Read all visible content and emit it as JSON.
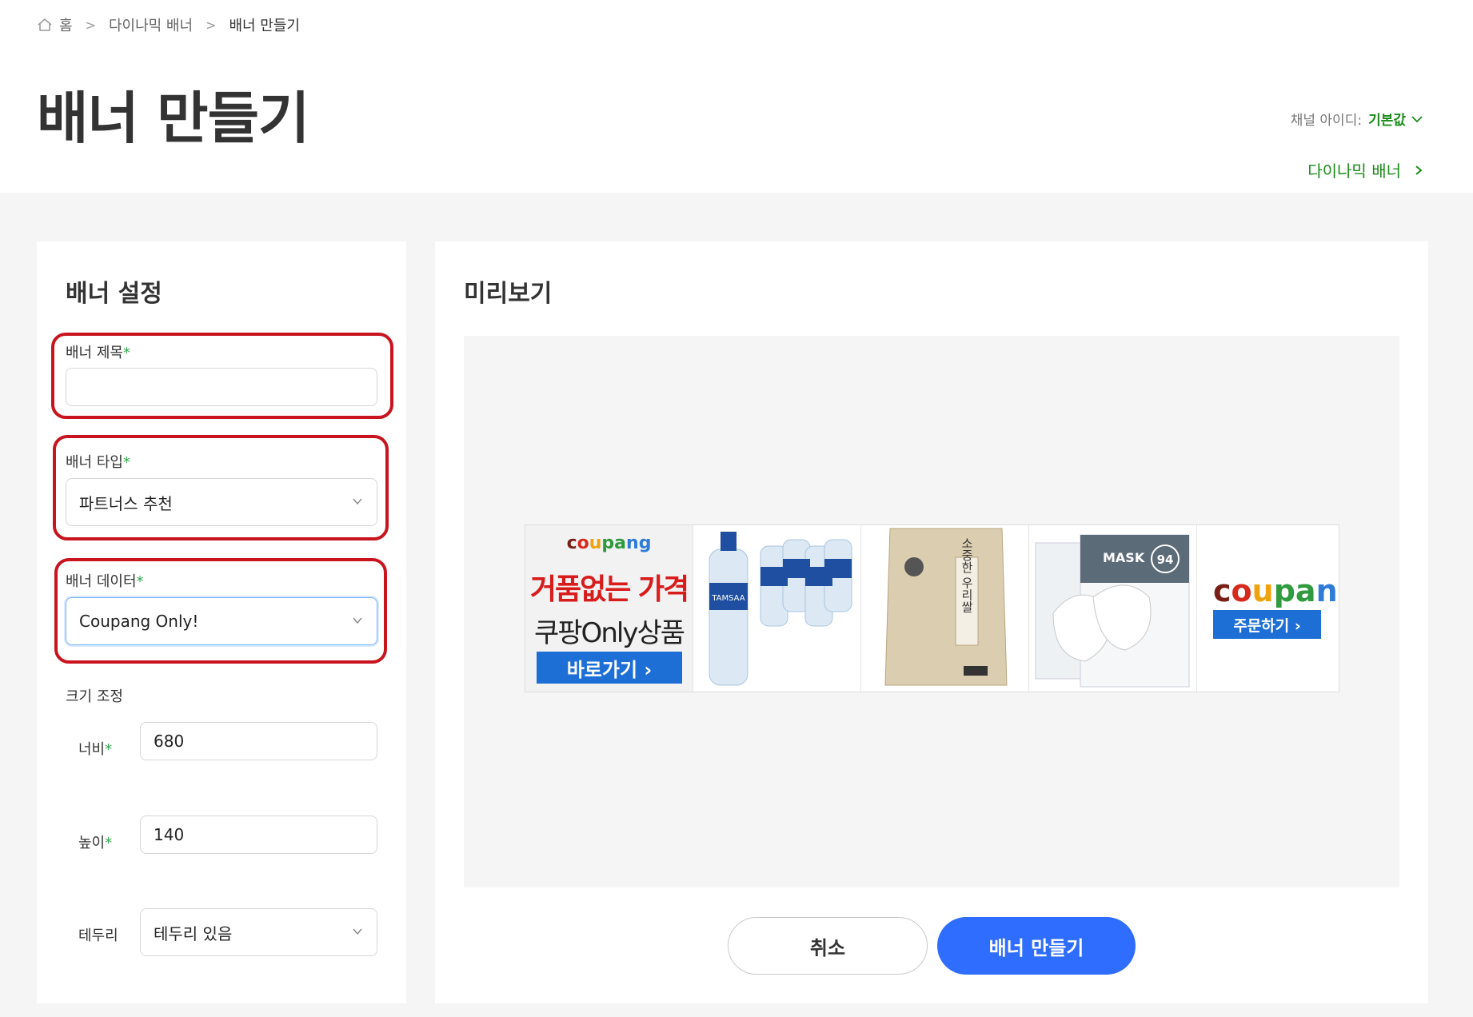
{
  "breadcrumb": {
    "home": "홈",
    "parent": "다이나믹 배너",
    "current": "배너 만들기"
  },
  "page_title": "배너 만들기",
  "channel": {
    "label": "채널 아이디:",
    "value": "기본값"
  },
  "dynamic_link": "다이나믹 배너",
  "settings": {
    "title": "배너 설정",
    "banner_title": {
      "label": "배너 제목",
      "required": "*",
      "value": ""
    },
    "banner_type": {
      "label": "배너 타입",
      "required": "*",
      "value": "파트너스 추천"
    },
    "banner_data": {
      "label": "배너 데이터",
      "required": "*",
      "value": "Coupang Only!"
    },
    "size_label": "크기 조정",
    "width": {
      "label": "너비",
      "required": "*",
      "value": "680"
    },
    "height": {
      "label": "높이",
      "required": "*",
      "value": "140"
    },
    "border": {
      "label": "테두리",
      "value": "테두리 있음"
    }
  },
  "preview": {
    "title": "미리보기",
    "banner": {
      "logo": [
        "c",
        "o",
        "u",
        "p",
        "a",
        "n",
        "g"
      ],
      "promo_line1": "거품없는 가격",
      "promo_line2": "쿠팡Only상품",
      "promo_button": "바로가기 ›",
      "order_button": "주문하기 ›",
      "product_texts": {
        "water": "TAMSAA",
        "rice": "소중한 우리쌀",
        "mask_brand": "MASK",
        "mask_grade": "94"
      }
    }
  },
  "buttons": {
    "cancel": "취소",
    "create": "배너 만들기"
  },
  "colors": {
    "accent_green": "#1a8c1a",
    "primary_blue": "#2f6dff",
    "highlight_red": "#c8141e",
    "banner_blue": "#1d6fd6"
  }
}
